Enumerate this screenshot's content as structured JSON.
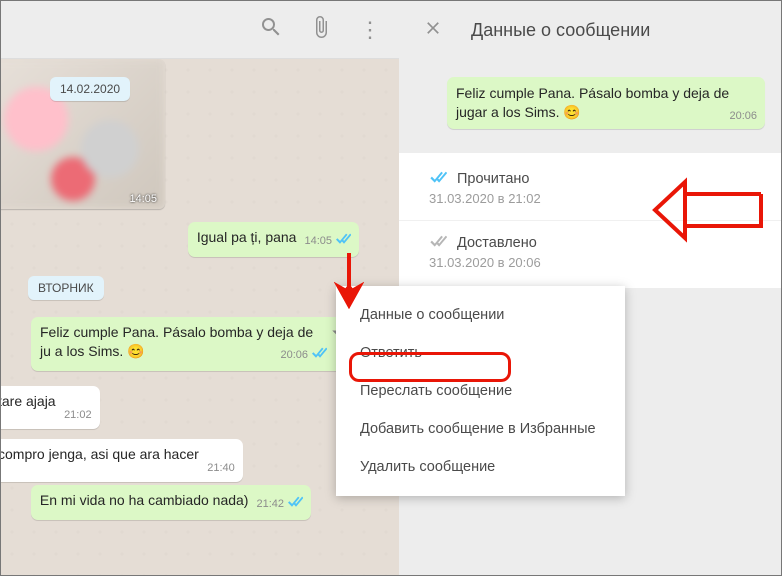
{
  "chat": {
    "date1": "14.02.2020",
    "date2": "ВТОРНИК",
    "thumb_time": "14:05",
    "msg1": {
      "text": "Igual pa ți, pana",
      "time": "14:05"
    },
    "msg2": {
      "text": "Feliz cumple Pana. Pásalo bomba y deja de ju a los Sims. 😊",
      "time": "20:06"
    },
    "msg3": {
      "text": "tare ajaja",
      "time": "21:02"
    },
    "msg4": {
      "text": "compro jenga, asi que ara hacer",
      "time": "21:40"
    },
    "msg5": {
      "text": "En  mi vida no ha cambiado nada)",
      "time": "21:42"
    }
  },
  "context_menu": {
    "info": "Данные о сообщении",
    "reply": "Ответить",
    "forward": "Переслать сообщение",
    "star": "Добавить сообщение в Избранные",
    "delete": "Удалить сообщение"
  },
  "info_panel": {
    "title": "Данные о сообщении",
    "quote_text": "Feliz cumple Pana. Pásalo bomba y deja de jugar a los Sims. 😊",
    "quote_time": "20:06",
    "read_label": "Прочитано",
    "read_time": "31.03.2020 в 21:02",
    "delivered_label": "Доставлено",
    "delivered_time": "31.03.2020 в 20:06"
  }
}
